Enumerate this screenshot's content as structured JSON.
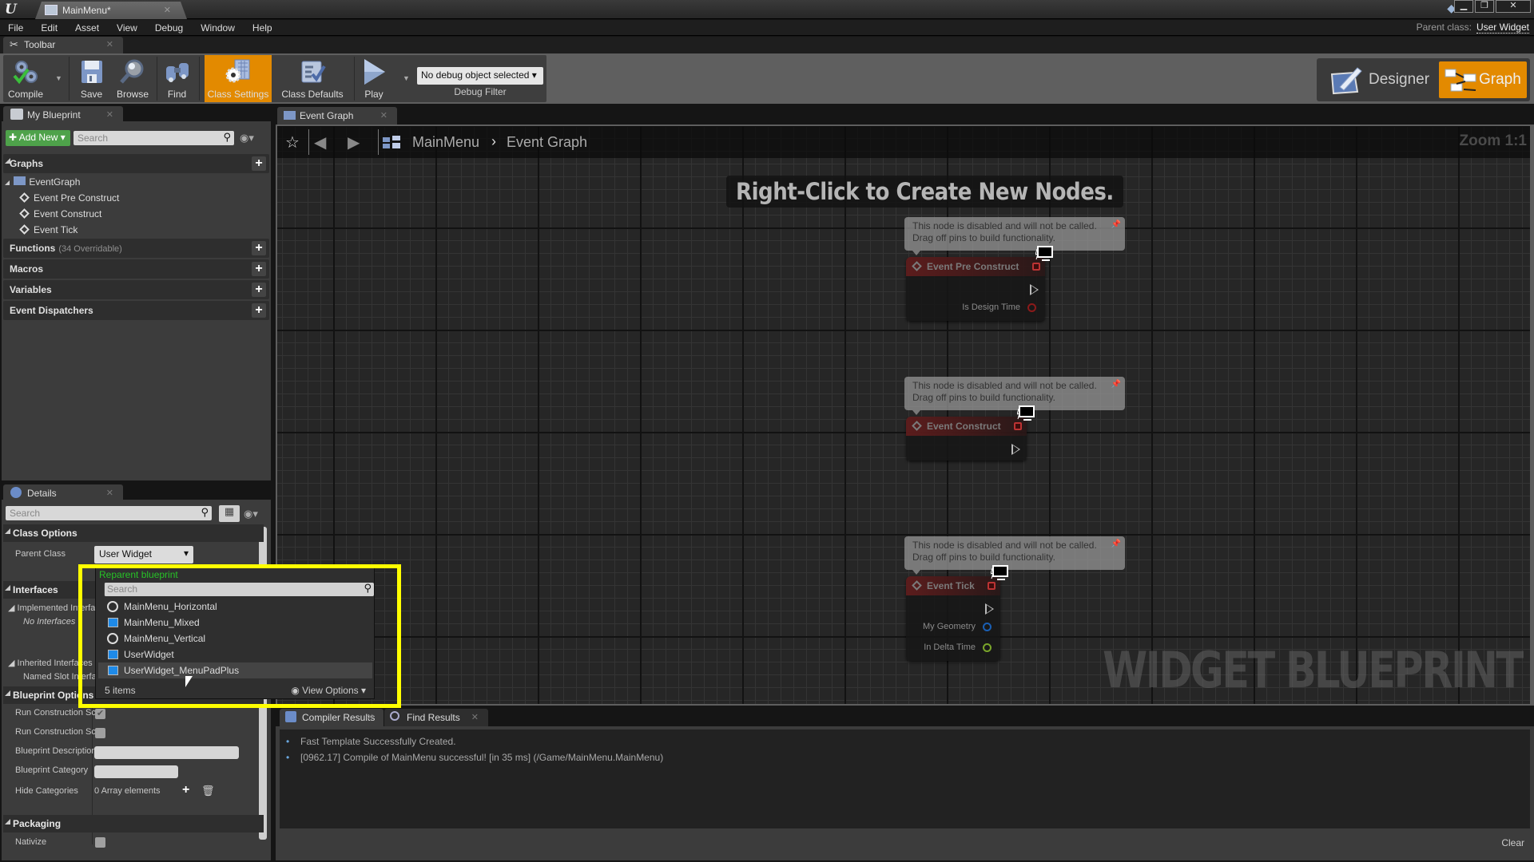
{
  "window": {
    "document_tab": "MainMenu*",
    "controls": {
      "minimize": "▁",
      "restore": "❐",
      "close": "✕"
    }
  },
  "menu": [
    "File",
    "Edit",
    "Asset",
    "View",
    "Debug",
    "Window",
    "Help"
  ],
  "parent_class": {
    "label": "Parent class:",
    "value": "User Widget"
  },
  "toolbar": {
    "tab_label": "Toolbar",
    "buttons": [
      {
        "id": "compile",
        "label": "Compile",
        "icon": "compile-gears-check-icon"
      },
      {
        "id": "save",
        "label": "Save",
        "icon": "floppy-disk-icon"
      },
      {
        "id": "browse",
        "label": "Browse",
        "icon": "magnifier-icon"
      },
      {
        "id": "find",
        "label": "Find",
        "icon": "binoculars-icon"
      },
      {
        "id": "class_settings",
        "label": "Class Settings",
        "icon": "gear-sheet-icon",
        "active": true
      },
      {
        "id": "class_defaults",
        "label": "Class Defaults",
        "icon": "checklist-icon"
      },
      {
        "id": "play",
        "label": "Play",
        "icon": "play-icon"
      }
    ],
    "debug_object": "No debug object selected",
    "debug_filter_label": "Debug Filter"
  },
  "mode_switch": {
    "designer": "Designer",
    "graph": "Graph",
    "active": "Graph"
  },
  "my_blueprint": {
    "tab_label": "My Blueprint",
    "add_new": "Add New",
    "search_placeholder": "Search",
    "sections": {
      "graphs": "Graphs",
      "functions": "Functions",
      "functions_sub": "(34 Overridable)",
      "macros": "Macros",
      "variables": "Variables",
      "dispatchers": "Event Dispatchers"
    },
    "event_graph": "EventGraph",
    "events": [
      "Event Pre Construct",
      "Event Construct",
      "Event Tick"
    ]
  },
  "details": {
    "tab_label": "Details",
    "search_placeholder": "Search",
    "class_options": "Class Options",
    "parent_class_label": "Parent Class",
    "parent_class_value": "User Widget",
    "interfaces": "Interfaces",
    "implemented_interfaces": "Implemented Interfaces",
    "no_interfaces": "No Interfaces",
    "inherited_interfaces": "Inherited Interfaces",
    "named_slot": "Named Slot Interface",
    "blueprint_options": "Blueprint Options",
    "run_construction_1": "Run Construction Script on Drag",
    "run_construction_1_checked": true,
    "run_construction_2": "Run Construction Script in Sequencer",
    "run_construction_2_checked": false,
    "bp_description": "Blueprint Description",
    "bp_description_value": "",
    "bp_category": "Blueprint Category",
    "bp_category_value": "",
    "hide_categories": "Hide Categories",
    "hide_categories_value": "0 Array elements",
    "packaging": "Packaging",
    "nativize": "Nativize",
    "nativize_checked": false
  },
  "reparent_popup": {
    "title": "Reparent blueprint",
    "search_placeholder": "Search",
    "items": [
      {
        "label": "MainMenu_Horizontal",
        "icon": "circle"
      },
      {
        "label": "MainMenu_Mixed",
        "icon": "square"
      },
      {
        "label": "MainMenu_Vertical",
        "icon": "circle"
      },
      {
        "label": "UserWidget",
        "icon": "square"
      },
      {
        "label": "UserWidget_MenuPadPlus",
        "icon": "square",
        "hovered": true
      }
    ],
    "count": "5 items",
    "view_options": "View Options"
  },
  "graph": {
    "tab_label": "Event Graph",
    "breadcrumb": [
      "MainMenu",
      "Event Graph"
    ],
    "zoom": "Zoom 1:1",
    "hint": "Right-Click to Create New Nodes.",
    "watermark": "WIDGET BLUEPRINT",
    "comment_text_1": "This node is disabled and will not be called.",
    "comment_text_2": "Drag off pins to build functionality.",
    "nodes": [
      {
        "title": "Event Pre Construct",
        "pins": [
          "Is Design Time"
        ]
      },
      {
        "title": "Event Construct",
        "pins": []
      },
      {
        "title": "Event Tick",
        "pins": [
          "My Geometry",
          "In Delta Time"
        ]
      }
    ],
    "colors": {
      "bool_pin": "#8b1a1a",
      "struct_pin": "#1a5fb4",
      "float_pin": "#7aa52a"
    }
  },
  "bottom": {
    "tabs": [
      "Compiler Results",
      "Find Results"
    ],
    "log": [
      "Fast Template Successfully Created.",
      "[0962.17] Compile of MainMenu successful! [in 35 ms] (/Game/MainMenu.MainMenu)"
    ],
    "clear": "Clear"
  },
  "colors": {
    "accent_orange": "#e38a00",
    "add_green": "#4ea24a",
    "highlight_yellow": "#ffff00"
  }
}
